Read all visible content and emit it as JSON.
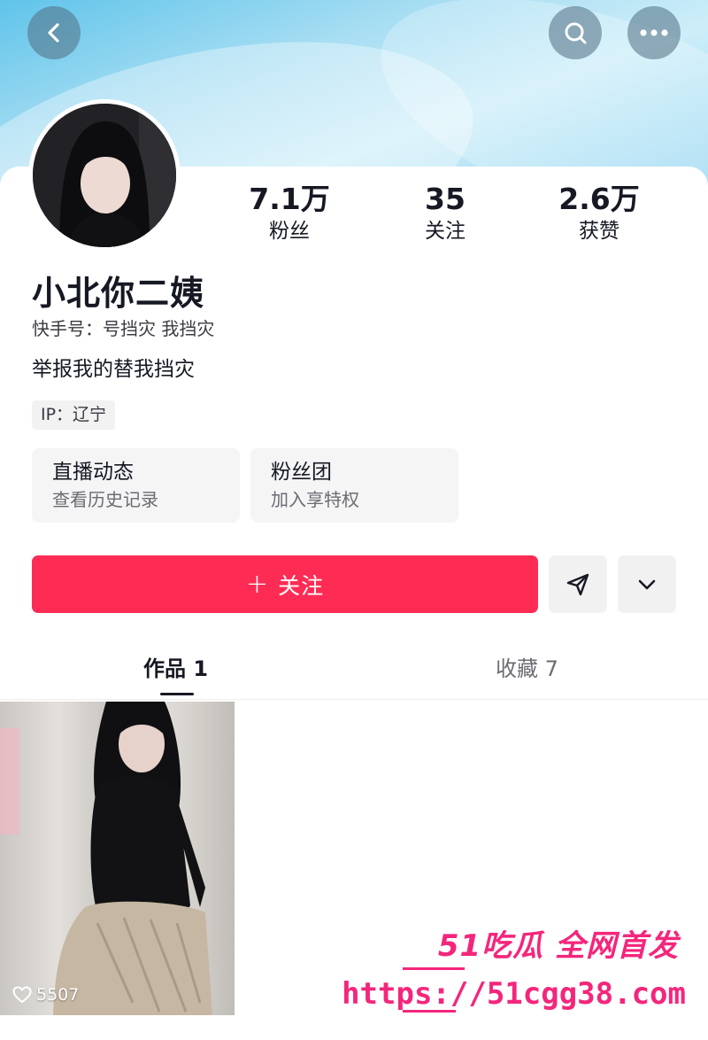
{
  "header": {
    "back_icon": "chevron-left-icon",
    "search_icon": "search-icon",
    "more_icon": "more-dots-icon"
  },
  "profile": {
    "name": "小北你二姨",
    "account_label": "快手号：号挡灾  我挡灾",
    "bio": "举报我的替我挡灾",
    "ip": "IP：辽宁"
  },
  "stats": [
    {
      "value": "7.1万",
      "label": "粉丝"
    },
    {
      "value": "35",
      "label": "关注"
    },
    {
      "value": "2.6万",
      "label": "获赞"
    }
  ],
  "features": [
    {
      "title": "直播动态",
      "subtitle": "查看历史记录"
    },
    {
      "title": "粉丝团",
      "subtitle": "加入享特权"
    }
  ],
  "actions": {
    "follow_plus": "+",
    "follow_label": "关注",
    "share_icon": "send-icon",
    "expand_icon": "chevron-down-icon"
  },
  "tabs": [
    {
      "label": "作品 1",
      "active": true
    },
    {
      "label": "收藏 7",
      "active": false
    }
  ],
  "works": [
    {
      "likes": "5507",
      "icon": "heart-outline-icon"
    }
  ],
  "watermark": {
    "brand": "51吃瓜 全网首发",
    "url": "https://51cgg38.com"
  },
  "colors": {
    "accent": "#fe2c55",
    "watermark": "#f4267c"
  }
}
